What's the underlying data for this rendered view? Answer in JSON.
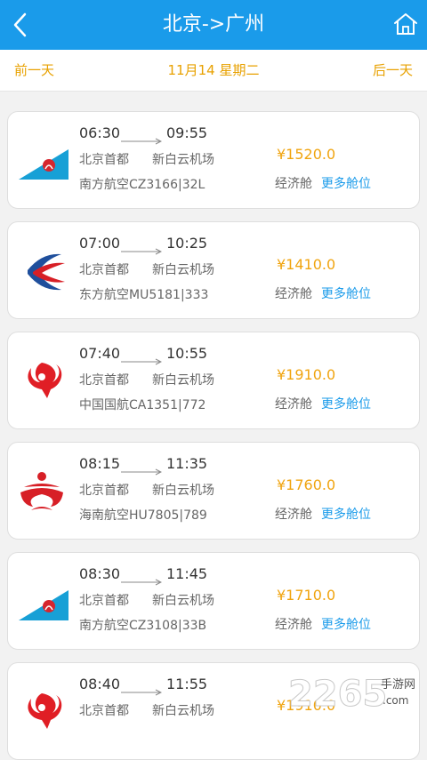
{
  "header": {
    "title": "北京->广州",
    "back_icon": "back-chevron-icon",
    "home_icon": "home-icon"
  },
  "date_nav": {
    "prev": "前一天",
    "current": "11月14 星期二",
    "next": "后一天"
  },
  "colors": {
    "header_bg": "#1a9bea",
    "accent_orange": "#f0a40f",
    "link_blue": "#1a9bea"
  },
  "flights": [
    {
      "airline_logo": "china-southern-logo",
      "dep_time": "06:30",
      "arr_time": "09:55",
      "dep_airport": "北京首都",
      "arr_airport": "新白云机场",
      "flight": "南方航空CZ3166|32L",
      "price": "¥1520.0",
      "cabin": "经济舱",
      "more": "更多舱位"
    },
    {
      "airline_logo": "china-eastern-logo",
      "dep_time": "07:00",
      "arr_time": "10:25",
      "dep_airport": "北京首都",
      "arr_airport": "新白云机场",
      "flight": "东方航空MU5181|333",
      "price": "¥1410.0",
      "cabin": "经济舱",
      "more": "更多舱位"
    },
    {
      "airline_logo": "air-china-logo",
      "dep_time": "07:40",
      "arr_time": "10:55",
      "dep_airport": "北京首都",
      "arr_airport": "新白云机场",
      "flight": "中国国航CA1351|772",
      "price": "¥1910.0",
      "cabin": "经济舱",
      "more": "更多舱位"
    },
    {
      "airline_logo": "hainan-airlines-logo",
      "dep_time": "08:15",
      "arr_time": "11:35",
      "dep_airport": "北京首都",
      "arr_airport": "新白云机场",
      "flight": "海南航空HU7805|789",
      "price": "¥1760.0",
      "cabin": "经济舱",
      "more": "更多舱位"
    },
    {
      "airline_logo": "china-southern-logo",
      "dep_time": "08:30",
      "arr_time": "11:45",
      "dep_airport": "北京首都",
      "arr_airport": "新白云机场",
      "flight": "南方航空CZ3108|33B",
      "price": "¥1710.0",
      "cabin": "经济舱",
      "more": "更多舱位"
    },
    {
      "airline_logo": "air-china-logo",
      "dep_time": "08:40",
      "arr_time": "11:55",
      "dep_airport": "北京首都",
      "arr_airport": "新白云机场",
      "flight": "",
      "price": "¥1910.0",
      "cabin": "",
      "more": ""
    }
  ],
  "watermark": {
    "brand": "2265",
    "suffix": "手游网",
    "domain": ".com"
  }
}
